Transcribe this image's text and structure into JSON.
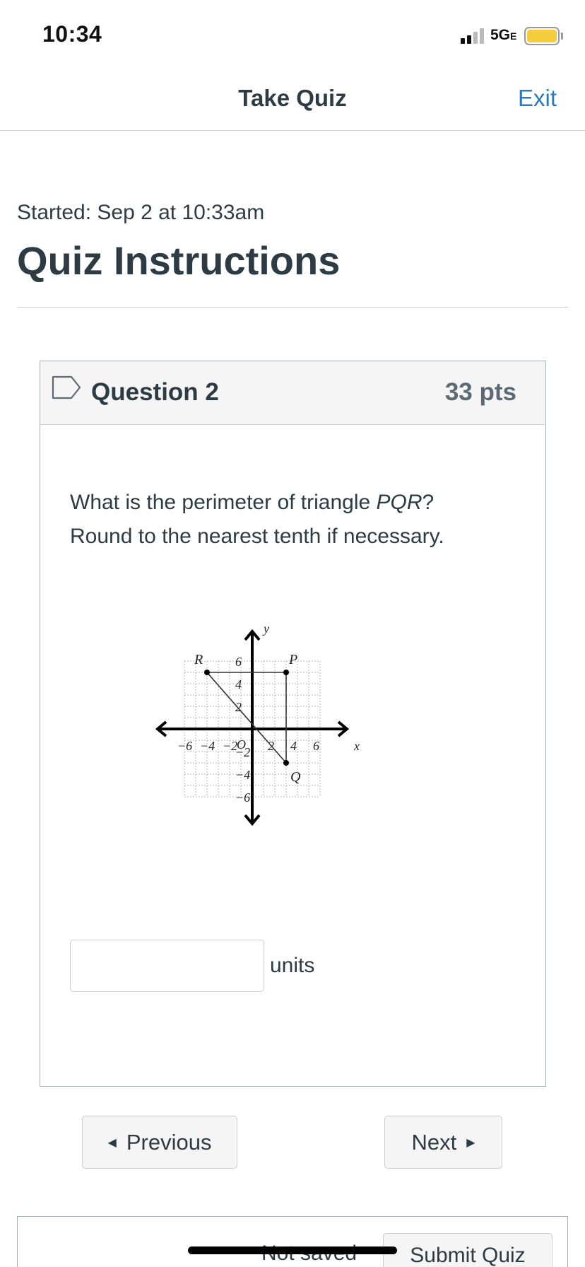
{
  "status_bar": {
    "time": "10:34",
    "network": "5G",
    "network_suffix": "E",
    "battery_color": "#f5cc3c"
  },
  "nav": {
    "title": "Take Quiz",
    "exit_label": "Exit",
    "exit_color": "#2b7abc"
  },
  "quiz": {
    "started": "Started: Sep 2 at 10:33am",
    "title": "Quiz Instructions"
  },
  "question": {
    "title": "Question 2",
    "points": "33 pts",
    "text_line1_prefix": "What is the perimeter of triangle ",
    "text_line1_italic": "PQR",
    "text_line1_suffix": "?",
    "text_line2": "Round to the nearest tenth if necessary.",
    "answer_value": "",
    "units_label": "units",
    "bookmark_icon": "bookmark-outline-icon"
  },
  "graph": {
    "x_axis_label": "x",
    "y_axis_label": "y",
    "origin_label": "O",
    "x_tick_labels": [
      "−6",
      "−4",
      "−2",
      "2",
      "4",
      "6"
    ],
    "y_tick_labels": [
      "6",
      "4",
      "2",
      "−2",
      "−4",
      "−6"
    ],
    "points": [
      {
        "label": "R",
        "x": -4,
        "y": 5
      },
      {
        "label": "P",
        "x": 3,
        "y": 5
      },
      {
        "label": "Q",
        "x": 3,
        "y": -3
      }
    ],
    "grid_range": [
      -6,
      6
    ]
  },
  "navigation": {
    "previous_label": "Previous",
    "next_label": "Next"
  },
  "footer": {
    "status": "Not saved",
    "submit_label": "Submit Quiz"
  }
}
